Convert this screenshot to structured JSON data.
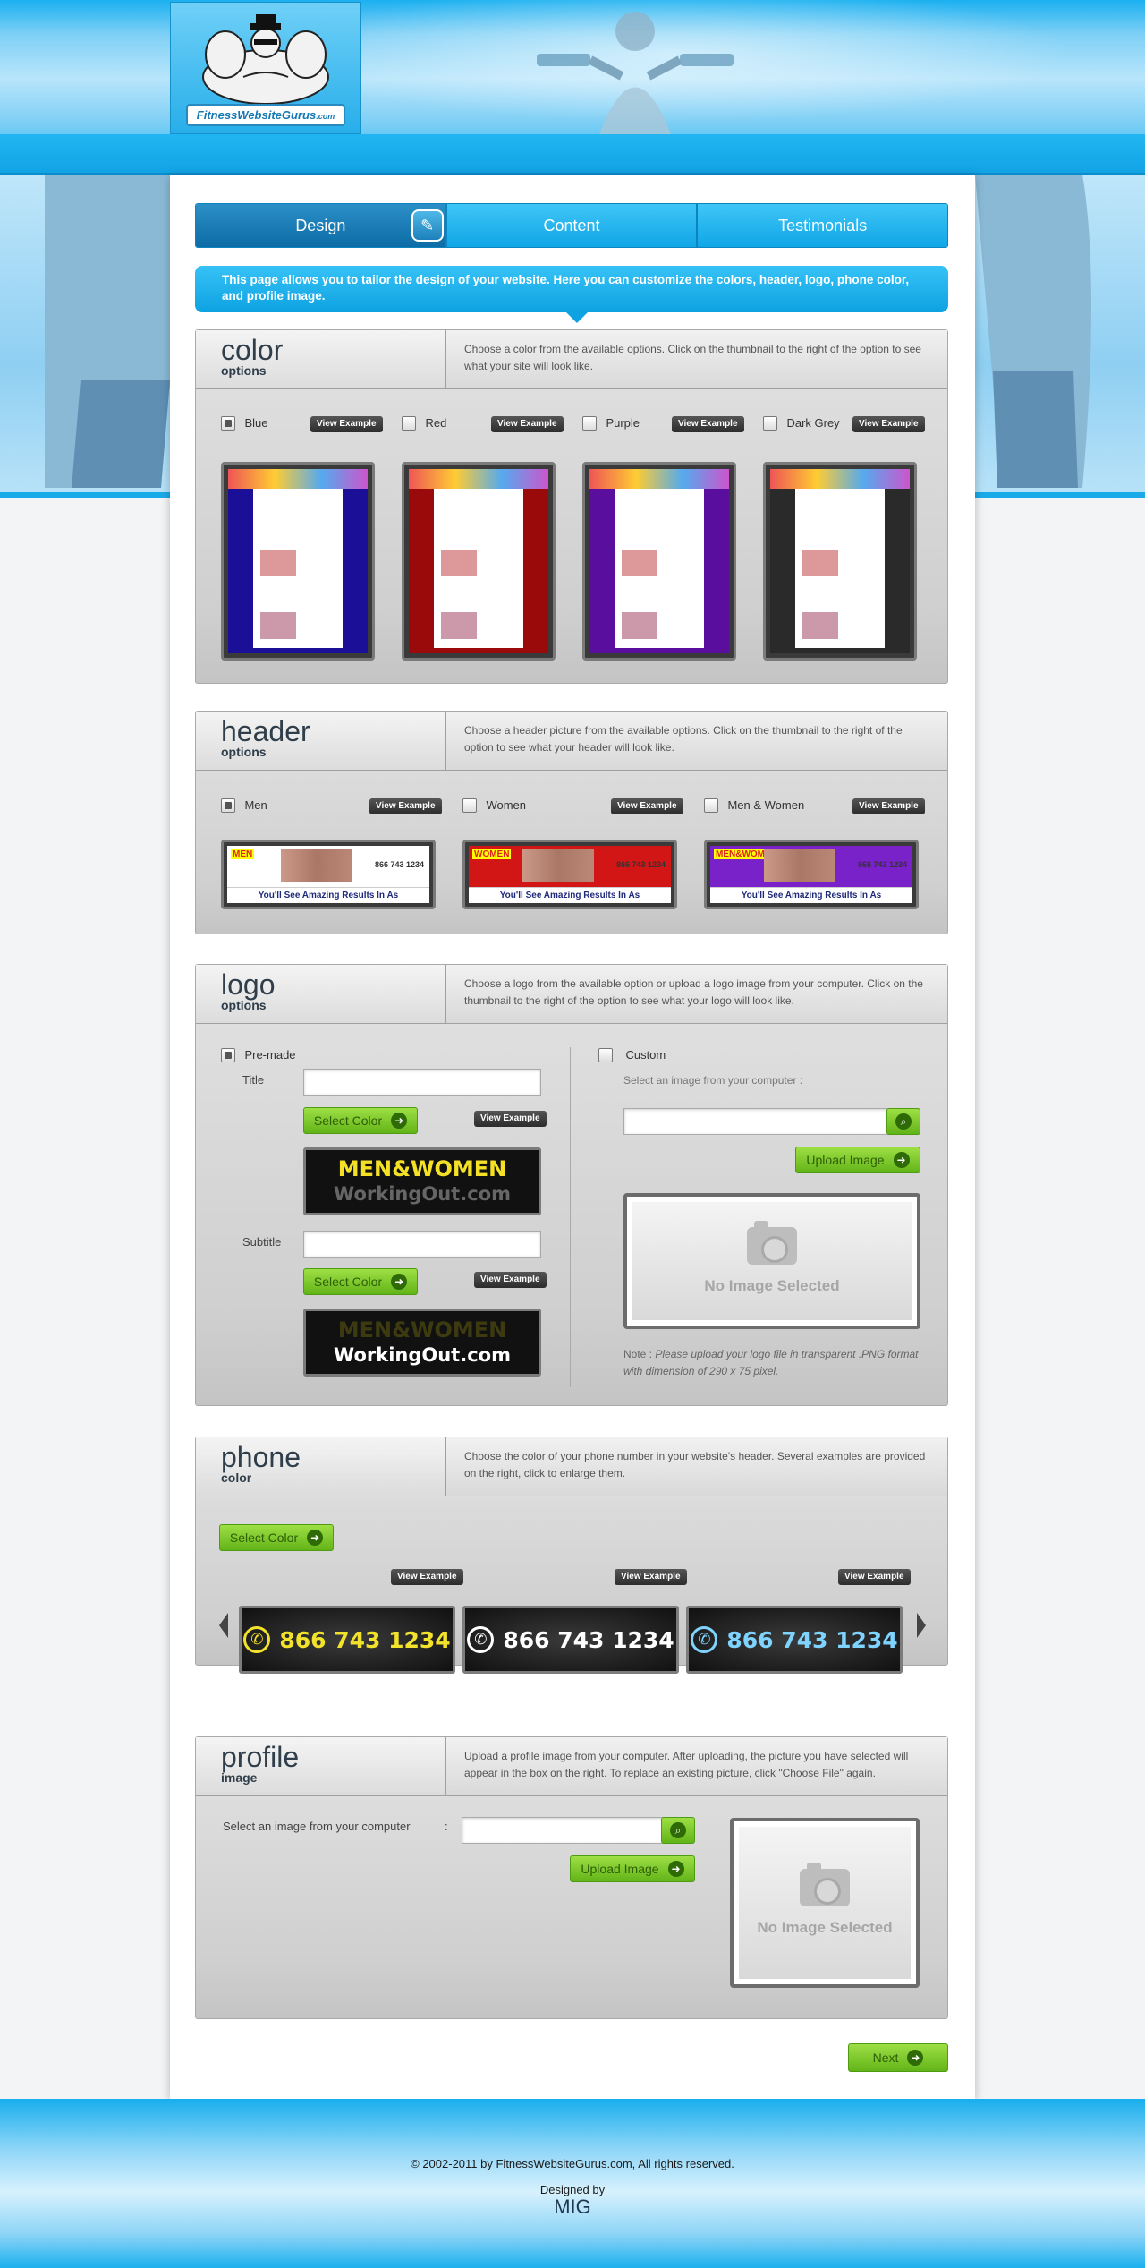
{
  "header": {
    "logo_text": "FitnessWebsiteGurus",
    "logo_sub": ".com"
  },
  "tabs": [
    {
      "label": "Design",
      "active": true
    },
    {
      "label": "Content",
      "active": false
    },
    {
      "label": "Testimonials",
      "active": false
    }
  ],
  "intro": "This page allows you to tailor the design of your website. Here you can customize the colors, header, logo, phone color, and profile image.",
  "view_example": "View Example",
  "color": {
    "title": "color",
    "subtitle": "options",
    "description": "Choose a color from the available options. Click on the thumbnail to the right of the option to see what your site will look like.",
    "options": [
      {
        "label": "Blue",
        "checked": true,
        "accent": "#1a0f96"
      },
      {
        "label": "Red",
        "checked": false,
        "accent": "#9b0a0a"
      },
      {
        "label": "Purple",
        "checked": false,
        "accent": "#5a0e9e"
      },
      {
        "label": "Dark Grey",
        "checked": false,
        "accent": "#2a2a2a"
      }
    ]
  },
  "header_opts": {
    "title": "header",
    "subtitle": "options",
    "description": "Choose a header picture from the available options. Click on the thumbnail to the right of the option to see what your header will look like.",
    "options": [
      {
        "label": "Men",
        "checked": true,
        "banner_label": "MEN",
        "banner_text": "You'll See Amazing Results In As",
        "accent": "#ffffff"
      },
      {
        "label": "Women",
        "checked": false,
        "banner_label": "WOMEN",
        "banner_text": "You'll See Amazing Results In As",
        "accent": "#d21616"
      },
      {
        "label": "Men & Women",
        "checked": false,
        "banner_label": "MEN&WOMEN",
        "banner_text": "You'll See Amazing Results In As",
        "accent": "#7a22c9"
      }
    ],
    "phone_text": "866 743 1234"
  },
  "logo": {
    "title": "logo",
    "subtitle": "options",
    "description": "Choose a logo from the available option or upload a logo image from your computer. Click on the thumbnail to the right of the option to see what your logo will look like.",
    "premade_label": "Pre-made",
    "premade_checked": true,
    "title_label": "Title",
    "subtitle_label": "Subtitle",
    "select_color": "Select Color",
    "sample_line1": "MEN&WOMEN",
    "sample_line2": "WorkingOut.com",
    "custom_label": "Custom",
    "custom_checked": false,
    "select_image": "Select an image from your computer :",
    "upload_image": "Upload Image",
    "no_image": "No Image Selected",
    "note_prefix": "Note : ",
    "note_text": "Please upload your logo file in transparent .PNG format with dimension of 290 x 75 pixel."
  },
  "phone": {
    "title": "phone",
    "subtitle": "color",
    "description": "Choose the color of your phone number in your website's header. Several examples are provided on the right, click to enlarge them.",
    "select_color": "Select Color",
    "number": "866 743 1234",
    "samples": [
      {
        "color": "#f2e22c"
      },
      {
        "color": "#ffffff"
      },
      {
        "color": "#7fd3ff"
      }
    ]
  },
  "profile": {
    "title": "profile",
    "subtitle": "image",
    "description": "Upload a profile image from your computer. After uploading, the picture you have selected will appear in the box on the right. To replace an existing picture, click \"Choose File\" again.",
    "select_image": "Select an image from your computer",
    "colon": ":",
    "upload_image": "Upload Image",
    "no_image": "No Image Selected"
  },
  "next": "Next",
  "footer": {
    "copyright": "© 2002-2011 by FitnessWebsiteGurus.com, All rights reserved.",
    "designed_by": "Designed by",
    "designer": "MIG"
  }
}
